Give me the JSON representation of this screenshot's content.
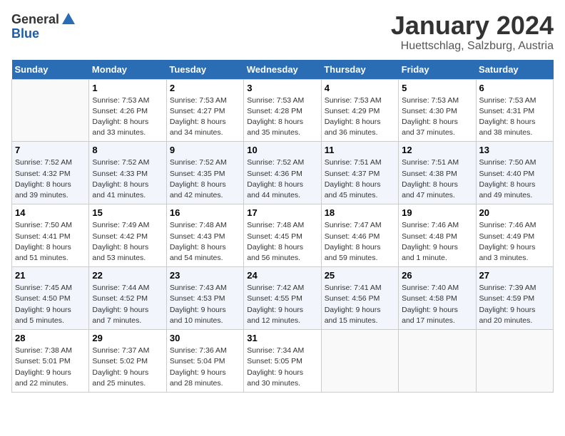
{
  "logo": {
    "general": "General",
    "blue": "Blue"
  },
  "title": "January 2024",
  "subtitle": "Huettschlag, Salzburg, Austria",
  "days_of_week": [
    "Sunday",
    "Monday",
    "Tuesday",
    "Wednesday",
    "Thursday",
    "Friday",
    "Saturday"
  ],
  "weeks": [
    [
      {
        "day": "",
        "sunrise": "",
        "sunset": "",
        "daylight": ""
      },
      {
        "day": "1",
        "sunrise": "Sunrise: 7:53 AM",
        "sunset": "Sunset: 4:26 PM",
        "daylight": "Daylight: 8 hours and 33 minutes."
      },
      {
        "day": "2",
        "sunrise": "Sunrise: 7:53 AM",
        "sunset": "Sunset: 4:27 PM",
        "daylight": "Daylight: 8 hours and 34 minutes."
      },
      {
        "day": "3",
        "sunrise": "Sunrise: 7:53 AM",
        "sunset": "Sunset: 4:28 PM",
        "daylight": "Daylight: 8 hours and 35 minutes."
      },
      {
        "day": "4",
        "sunrise": "Sunrise: 7:53 AM",
        "sunset": "Sunset: 4:29 PM",
        "daylight": "Daylight: 8 hours and 36 minutes."
      },
      {
        "day": "5",
        "sunrise": "Sunrise: 7:53 AM",
        "sunset": "Sunset: 4:30 PM",
        "daylight": "Daylight: 8 hours and 37 minutes."
      },
      {
        "day": "6",
        "sunrise": "Sunrise: 7:53 AM",
        "sunset": "Sunset: 4:31 PM",
        "daylight": "Daylight: 8 hours and 38 minutes."
      }
    ],
    [
      {
        "day": "7",
        "sunrise": "Sunrise: 7:52 AM",
        "sunset": "Sunset: 4:32 PM",
        "daylight": "Daylight: 8 hours and 39 minutes."
      },
      {
        "day": "8",
        "sunrise": "Sunrise: 7:52 AM",
        "sunset": "Sunset: 4:33 PM",
        "daylight": "Daylight: 8 hours and 41 minutes."
      },
      {
        "day": "9",
        "sunrise": "Sunrise: 7:52 AM",
        "sunset": "Sunset: 4:35 PM",
        "daylight": "Daylight: 8 hours and 42 minutes."
      },
      {
        "day": "10",
        "sunrise": "Sunrise: 7:52 AM",
        "sunset": "Sunset: 4:36 PM",
        "daylight": "Daylight: 8 hours and 44 minutes."
      },
      {
        "day": "11",
        "sunrise": "Sunrise: 7:51 AM",
        "sunset": "Sunset: 4:37 PM",
        "daylight": "Daylight: 8 hours and 45 minutes."
      },
      {
        "day": "12",
        "sunrise": "Sunrise: 7:51 AM",
        "sunset": "Sunset: 4:38 PM",
        "daylight": "Daylight: 8 hours and 47 minutes."
      },
      {
        "day": "13",
        "sunrise": "Sunrise: 7:50 AM",
        "sunset": "Sunset: 4:40 PM",
        "daylight": "Daylight: 8 hours and 49 minutes."
      }
    ],
    [
      {
        "day": "14",
        "sunrise": "Sunrise: 7:50 AM",
        "sunset": "Sunset: 4:41 PM",
        "daylight": "Daylight: 8 hours and 51 minutes."
      },
      {
        "day": "15",
        "sunrise": "Sunrise: 7:49 AM",
        "sunset": "Sunset: 4:42 PM",
        "daylight": "Daylight: 8 hours and 53 minutes."
      },
      {
        "day": "16",
        "sunrise": "Sunrise: 7:48 AM",
        "sunset": "Sunset: 4:43 PM",
        "daylight": "Daylight: 8 hours and 54 minutes."
      },
      {
        "day": "17",
        "sunrise": "Sunrise: 7:48 AM",
        "sunset": "Sunset: 4:45 PM",
        "daylight": "Daylight: 8 hours and 56 minutes."
      },
      {
        "day": "18",
        "sunrise": "Sunrise: 7:47 AM",
        "sunset": "Sunset: 4:46 PM",
        "daylight": "Daylight: 8 hours and 59 minutes."
      },
      {
        "day": "19",
        "sunrise": "Sunrise: 7:46 AM",
        "sunset": "Sunset: 4:48 PM",
        "daylight": "Daylight: 9 hours and 1 minute."
      },
      {
        "day": "20",
        "sunrise": "Sunrise: 7:46 AM",
        "sunset": "Sunset: 4:49 PM",
        "daylight": "Daylight: 9 hours and 3 minutes."
      }
    ],
    [
      {
        "day": "21",
        "sunrise": "Sunrise: 7:45 AM",
        "sunset": "Sunset: 4:50 PM",
        "daylight": "Daylight: 9 hours and 5 minutes."
      },
      {
        "day": "22",
        "sunrise": "Sunrise: 7:44 AM",
        "sunset": "Sunset: 4:52 PM",
        "daylight": "Daylight: 9 hours and 7 minutes."
      },
      {
        "day": "23",
        "sunrise": "Sunrise: 7:43 AM",
        "sunset": "Sunset: 4:53 PM",
        "daylight": "Daylight: 9 hours and 10 minutes."
      },
      {
        "day": "24",
        "sunrise": "Sunrise: 7:42 AM",
        "sunset": "Sunset: 4:55 PM",
        "daylight": "Daylight: 9 hours and 12 minutes."
      },
      {
        "day": "25",
        "sunrise": "Sunrise: 7:41 AM",
        "sunset": "Sunset: 4:56 PM",
        "daylight": "Daylight: 9 hours and 15 minutes."
      },
      {
        "day": "26",
        "sunrise": "Sunrise: 7:40 AM",
        "sunset": "Sunset: 4:58 PM",
        "daylight": "Daylight: 9 hours and 17 minutes."
      },
      {
        "day": "27",
        "sunrise": "Sunrise: 7:39 AM",
        "sunset": "Sunset: 4:59 PM",
        "daylight": "Daylight: 9 hours and 20 minutes."
      }
    ],
    [
      {
        "day": "28",
        "sunrise": "Sunrise: 7:38 AM",
        "sunset": "Sunset: 5:01 PM",
        "daylight": "Daylight: 9 hours and 22 minutes."
      },
      {
        "day": "29",
        "sunrise": "Sunrise: 7:37 AM",
        "sunset": "Sunset: 5:02 PM",
        "daylight": "Daylight: 9 hours and 25 minutes."
      },
      {
        "day": "30",
        "sunrise": "Sunrise: 7:36 AM",
        "sunset": "Sunset: 5:04 PM",
        "daylight": "Daylight: 9 hours and 28 minutes."
      },
      {
        "day": "31",
        "sunrise": "Sunrise: 7:34 AM",
        "sunset": "Sunset: 5:05 PM",
        "daylight": "Daylight: 9 hours and 30 minutes."
      },
      {
        "day": "",
        "sunrise": "",
        "sunset": "",
        "daylight": ""
      },
      {
        "day": "",
        "sunrise": "",
        "sunset": "",
        "daylight": ""
      },
      {
        "day": "",
        "sunrise": "",
        "sunset": "",
        "daylight": ""
      }
    ]
  ]
}
